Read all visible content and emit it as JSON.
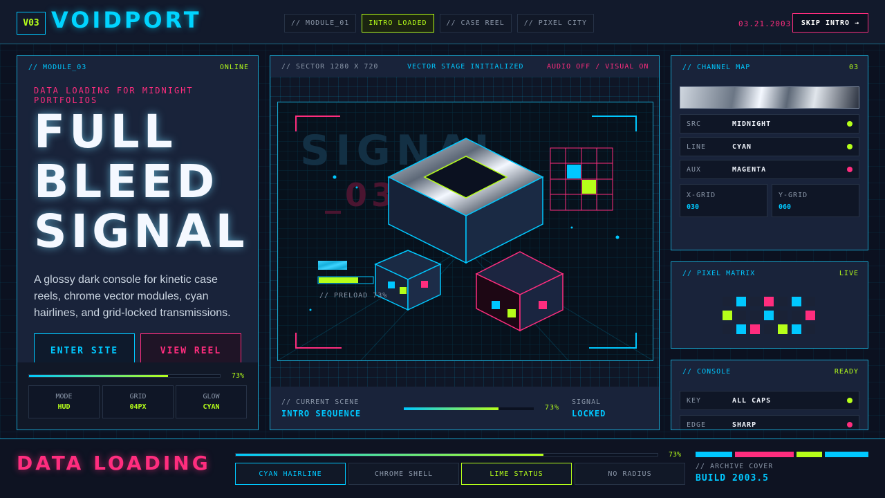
{
  "header": {
    "badge": "V03",
    "brand": "VOIDPORT",
    "tabs": [
      "// MODULE_01",
      "INTRO LOADED",
      "// CASE REEL",
      "// PIXEL CITY"
    ],
    "active_tab": "INTRO LOADED",
    "date": "03.21.2003",
    "skip_label": "SKIP INTRO →"
  },
  "left_panel": {
    "label": "// MODULE_03",
    "status": "ONLINE",
    "kicker": "DATA LOADING FOR MIDNIGHT PORTFOLIOS",
    "title_lines": [
      "FULL",
      "BLEED",
      "SIGNAL"
    ],
    "description": "A glossy dark console for kinetic case reels, chrome vector modules, cyan hairlines, and grid-locked transmissions.",
    "enter_label": "ENTER SITE",
    "reel_label": "VIEW REEL",
    "progress_pct": "73%",
    "progress_value": 0.73,
    "stats": [
      {
        "key": "MODE",
        "value": "HUD"
      },
      {
        "key": "GRID",
        "value": "04PX"
      },
      {
        "key": "GLOW",
        "value": "CYAN"
      }
    ]
  },
  "stage": {
    "sector": "// SECTOR 1280 X 720",
    "status": "VECTOR STAGE INITIALIZED",
    "audio": "AUDIO OFF / VISUAL ON",
    "bg_word": "SIGNAL",
    "bg_code": "_03",
    "preload": "// PRELOAD 73%",
    "scene_label": "// CURRENT SCENE",
    "scene_value": "INTRO SEQUENCE",
    "scene_pct": "73%",
    "scene_progress": 0.73,
    "signal_label": "SIGNAL",
    "signal_value": "LOCKED"
  },
  "channel_map": {
    "label": "// CHANNEL MAP",
    "count": "03",
    "rows": [
      {
        "key": "SRC",
        "value": "MIDNIGHT",
        "dot": "#b6ff1a"
      },
      {
        "key": "LINE",
        "value": "CYAN",
        "dot": "#b6ff1a"
      },
      {
        "key": "AUX",
        "value": "MAGENTA",
        "dot": "#ff2d7e"
      }
    ],
    "xgrid_label": "X-GRID",
    "xgrid_value": "030",
    "ygrid_label": "Y-GRID",
    "ygrid_value": "060"
  },
  "pixel_matrix": {
    "label": "// PIXEL MATRIX",
    "status": "LIVE",
    "cells": [
      "#1a2236",
      "#00c8ff",
      "#1a2236",
      "#ff2d7e",
      "#1a2236",
      "#00c8ff",
      "#1a2236",
      "#b6ff1a",
      "#1a2236",
      "#1a2236",
      "#00c8ff",
      "#1a2236",
      "#1a2236",
      "#ff2d7e",
      "#1a2236",
      "#00c8ff",
      "#ff2d7e",
      "#1a2236",
      "#b6ff1a",
      "#00c8ff",
      "#1a2236"
    ]
  },
  "console": {
    "label": "// CONSOLE",
    "status": "READY",
    "rows": [
      {
        "key": "KEY",
        "value": "ALL CAPS",
        "dot": "#b6ff1a"
      },
      {
        "key": "EDGE",
        "value": "SHARP",
        "dot": "#ff2d7e"
      }
    ]
  },
  "footer": {
    "title": "DATA LOADING",
    "pct": "73%",
    "progress_value": 0.73,
    "chips": [
      "CYAN HAIRLINE",
      "CHROME SHELL",
      "LIME STATUS",
      "NO RADIUS"
    ],
    "swatches": [
      "#00c8ff",
      "#ff2d7e",
      "#b6ff1a",
      "#00c8ff"
    ],
    "archive_label": "// ARCHIVE COVER",
    "archive_value": "BUILD 2003.5"
  },
  "colors": {
    "cyan": "#00c8ff",
    "lime": "#b6ff1a",
    "magenta": "#ff2d7e",
    "bg": "#0b1120"
  }
}
